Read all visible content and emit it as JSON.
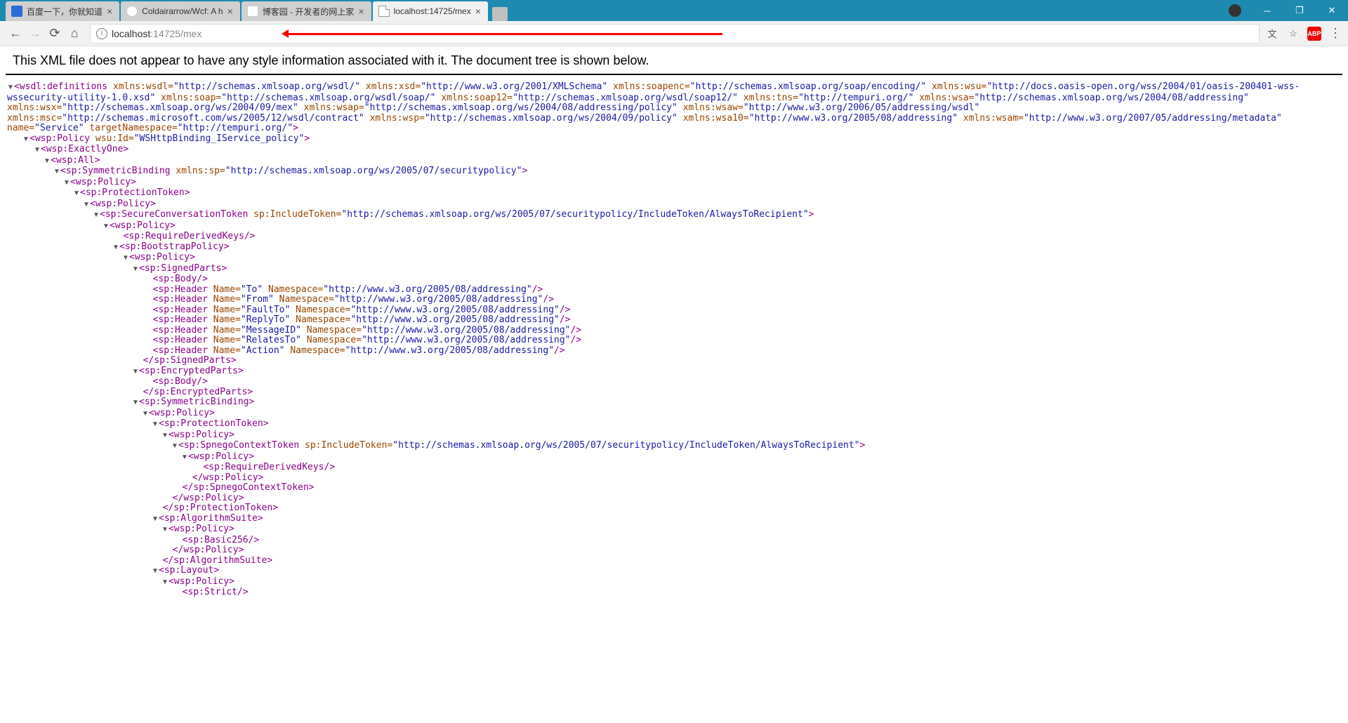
{
  "tabs": [
    {
      "label": "百度一下，你就知道"
    },
    {
      "label": "Coldairarrow/Wcf: A h"
    },
    {
      "label": "博客园 - 开发者的网上家"
    },
    {
      "label": "localhost:14725/mex"
    }
  ],
  "url": {
    "host": "localhost",
    "rest": ":14725/mex"
  },
  "notice": "This XML file does not appear to have any style information associated with it. The document tree is shown below.",
  "abp": "ABP",
  "defs": {
    "open": "<wsdl:definitions ",
    "a1_n": "xmlns:wsdl=",
    "a1_v": "\"http://schemas.xmlsoap.org/wsdl/\"",
    "a2_n": " xmlns:xsd=",
    "a2_v": "\"http://www.w3.org/2001/XMLSchema\"",
    "a3_n": " xmlns:soapenc=",
    "a3_v": "\"http://schemas.xmlsoap.org/soap/encoding/\"",
    "a4_n": " xmlns:wsu=",
    "a4_v": "\"http://docs.oasis-open.org/wss/2004/01/oasis-200401-wss-wssecurity-utility-1.0.xsd\"",
    "a5_n": " xmlns:soap=",
    "a5_v": "\"http://schemas.xmlsoap.org/wsdl/soap/\"",
    "a6_n": " xmlns:soap12=",
    "a6_v": "\"http://schemas.xmlsoap.org/wsdl/soap12/\"",
    "a7_n": " xmlns:tns=",
    "a7_v": "\"http://tempuri.org/\"",
    "a8_n": " xmlns:wsa=",
    "a8_v": "\"http://schemas.xmlsoap.org/ws/2004/08/addressing\"",
    "a9_n": " xmlns:wsx=",
    "a9_v": "\"http://schemas.xmlsoap.org/ws/2004/09/mex\"",
    "a10_n": " xmlns:wsap=",
    "a10_v": "\"http://schemas.xmlsoap.org/ws/2004/08/addressing/policy\"",
    "a11_n": " xmlns:wsaw=",
    "a11_v": "\"http://www.w3.org/2006/05/addressing/wsdl\"",
    "a12_n": " xmlns:msc=",
    "a12_v": "\"http://schemas.microsoft.com/ws/2005/12/wsdl/contract\"",
    "a13_n": " xmlns:wsp=",
    "a13_v": "\"http://schemas.xmlsoap.org/ws/2004/09/policy\"",
    "a14_n": " xmlns:wsa10=",
    "a14_v": "\"http://www.w3.org/2005/08/addressing\"",
    "a15_n": " xmlns:wsam=",
    "a15_v": "\"http://www.w3.org/2007/05/addressing/metadata\"",
    "a16_n": " name=",
    "a16_v": "\"Service\"",
    "a17_n": " targetNamespace=",
    "a17_v": "\"http://tempuri.org/\"",
    "close": ">"
  },
  "n": {
    "policy_open": "<wsp:Policy ",
    "wsuid_n": "wsu:Id=",
    "wsuid_v": "\"WSHttpBinding_IService_policy\"",
    "gt": ">",
    "exactlyone": "<wsp:ExactlyOne>",
    "all": "<wsp:All>",
    "symb_open": "<sp:SymmetricBinding ",
    "symb_an": "xmlns:sp=",
    "symb_av": "\"http://schemas.xmlsoap.org/ws/2005/07/securitypolicy\"",
    "wsppolicy": "<wsp:Policy>",
    "prot": "<sp:ProtectionToken>",
    "sct_open": "<sp:SecureConversationToken ",
    "sct_an": "sp:IncludeToken=",
    "sct_av": "\"http://schemas.xmlsoap.org/ws/2005/07/securitypolicy/IncludeToken/AlwaysToRecipient\"",
    "reqdk": "<sp:RequireDerivedKeys/>",
    "boot": "<sp:BootstrapPolicy>",
    "signed": "<sp:SignedParts>",
    "body": "<sp:Body/>",
    "hdr_open": "<sp:Header ",
    "name_n": "Name=",
    "ns_n": " Namespace=",
    "ns_v": "\"http://www.w3.org/2005/08/addressing\"",
    "selfc": "/>",
    "h1": "\"To\"",
    "h2": "\"From\"",
    "h3": "\"FaultTo\"",
    "h4": "\"ReplyTo\"",
    "h5": "\"MessageID\"",
    "h6": "\"RelatesTo\"",
    "h7": "\"Action\"",
    "c_signed": "</sp:SignedParts>",
    "enc": "<sp:EncryptedParts>",
    "c_enc": "</sp:EncryptedParts>",
    "symb": "<sp:SymmetricBinding>",
    "spnego_open": "<sp:SpnegoContextToken ",
    "spnego_an": "sp:IncludeToken=",
    "spnego_av": "\"http://schemas.xmlsoap.org/ws/2005/07/securitypolicy/IncludeToken/AlwaysToRecipient\"",
    "c_wsppolicy": "</wsp:Policy>",
    "c_spnego": "</sp:SpnegoContextToken>",
    "c_prot": "</sp:ProtectionToken>",
    "algsuite": "<sp:AlgorithmSuite>",
    "basic256": "<sp:Basic256/>",
    "c_algsuite": "</sp:AlgorithmSuite>",
    "layout": "<sp:Layout>",
    "strict": "<sp:Strict/>"
  }
}
